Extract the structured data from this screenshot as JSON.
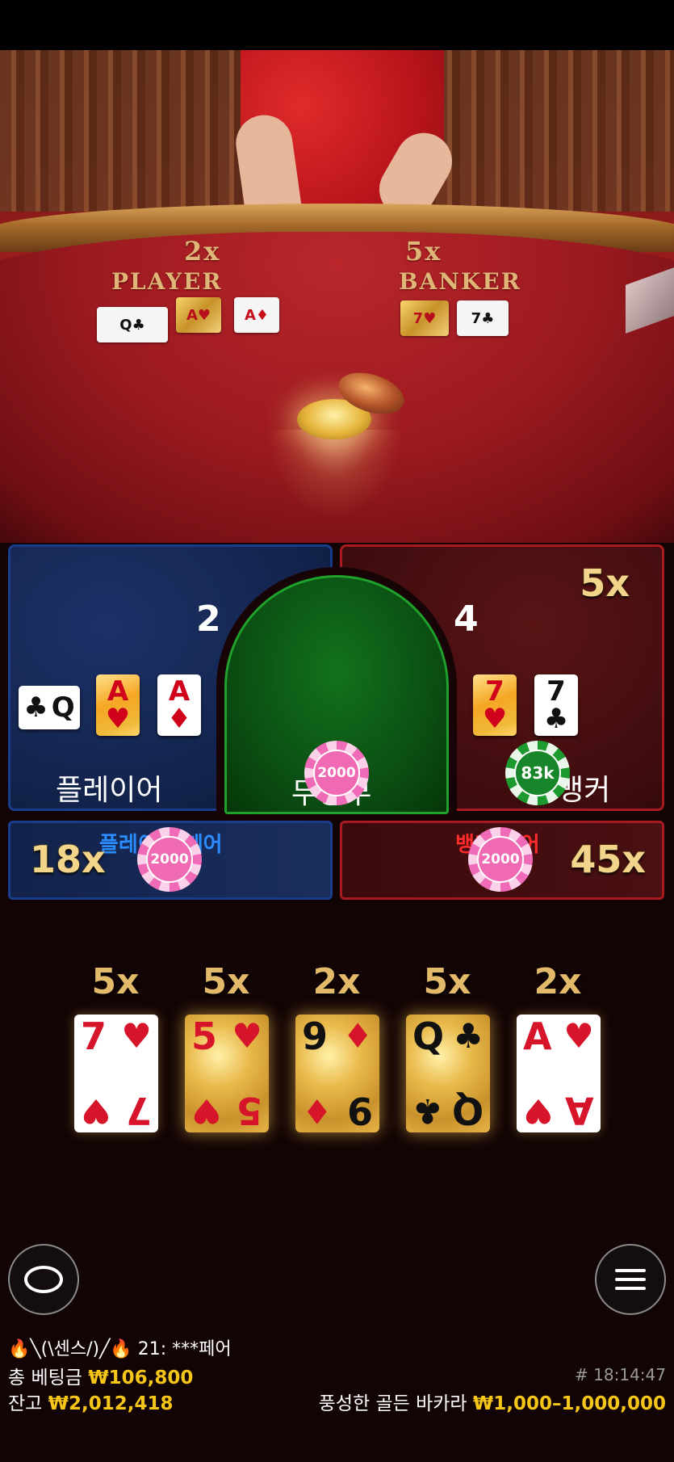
{
  "table": {
    "player_mult": "2x",
    "player_label": "PLAYER",
    "banker_mult": "5x",
    "banker_label": "BANKER",
    "player_cards": [
      {
        "rank": "Q",
        "suit": "♣",
        "gold": false,
        "red": false
      },
      {
        "rank": "A",
        "suit": "♥",
        "gold": true,
        "red": true
      },
      {
        "rank": "A",
        "suit": "♦",
        "gold": false,
        "red": true
      }
    ],
    "banker_cards": [
      {
        "rank": "7",
        "suit": "♥",
        "gold": true,
        "red": true
      },
      {
        "rank": "7",
        "suit": "♣",
        "gold": false,
        "red": false
      }
    ]
  },
  "bets": {
    "player": {
      "label": "플레이어",
      "score": "2"
    },
    "banker": {
      "label": "뱅커",
      "score": "4",
      "multiplier": "5x"
    },
    "tie": {
      "label": "무승부",
      "chip": "2000"
    },
    "banker_chip": "83k",
    "player_pair": {
      "label": "플레이어 페어",
      "multiplier": "18x",
      "chip": "2000"
    },
    "banker_pair": {
      "label": "뱅커 페어",
      "multiplier": "45x",
      "chip": "2000"
    }
  },
  "golden_cards": [
    {
      "multiplier": "5x",
      "rank": "7",
      "suit": "♥",
      "color": "red",
      "gold": false
    },
    {
      "multiplier": "5x",
      "rank": "5",
      "suit": "♥",
      "color": "red",
      "gold": true
    },
    {
      "multiplier": "2x",
      "rank": "9",
      "suit": "♦",
      "color": "red",
      "gold": true
    },
    {
      "multiplier": "5x",
      "rank": "Q",
      "suit": "♣",
      "color": "black",
      "gold": true
    },
    {
      "multiplier": "2x",
      "rank": "A",
      "suit": "♥",
      "color": "red",
      "gold": false
    }
  ],
  "controls": {
    "chat_icon": "chat-bubble-icon",
    "menu_icon": "hamburger-menu-icon"
  },
  "chat": {
    "fire1": "🔥",
    "user": "╲(\\센스/)╱",
    "fire2": "🔥",
    "message": "21: ***페어"
  },
  "footer": {
    "total_bet_label": "총 베팅금",
    "total_bet_value": "₩106,800",
    "balance_label": "잔고",
    "balance_value": "₩2,012,418",
    "round_id": "# 18:14:47",
    "game_name": "풍성한 골든 바카라",
    "limits": "₩1,000–1,000,000"
  },
  "colors": {
    "accent_gold": "#f5c518",
    "player_blue": "#1a3c8a",
    "banker_red": "#a81a20",
    "tie_green": "#1fa22c"
  }
}
